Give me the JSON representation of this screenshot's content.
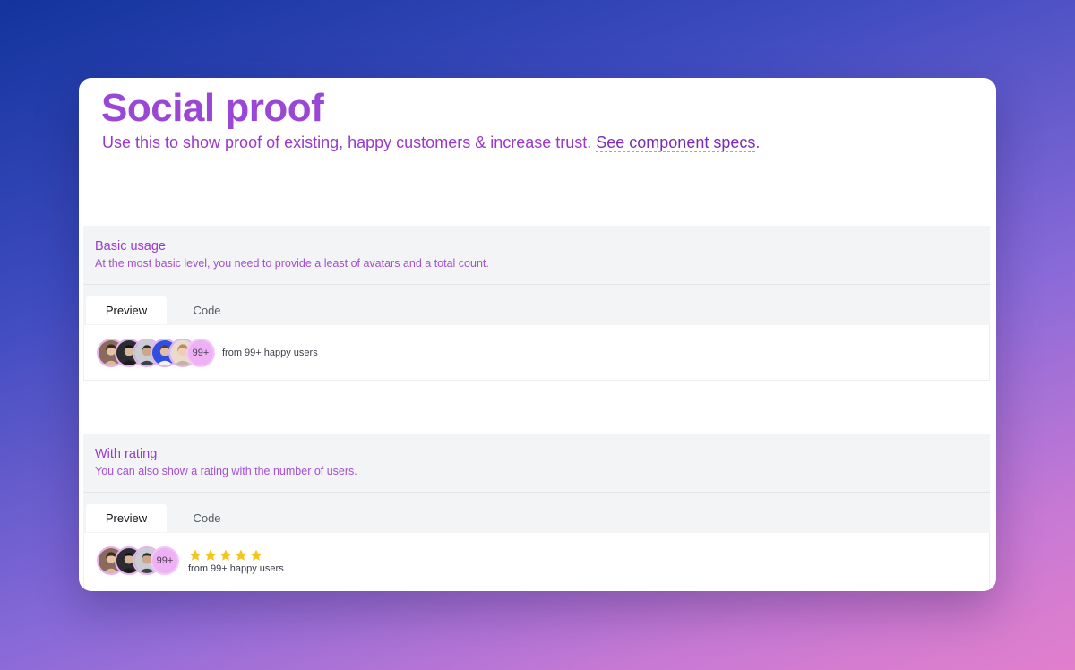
{
  "header": {
    "title": "Social proof",
    "subtitle_prefix": "Use this to show proof of existing, happy customers & increase trust. ",
    "specs_link": "See component specs",
    "subtitle_suffix": "."
  },
  "sections": [
    {
      "title": "Basic usage",
      "description": "At the most basic level, you need to provide a least of avatars and a total count.",
      "tabs": [
        {
          "label": "Preview",
          "active": true
        },
        {
          "label": "Code",
          "active": false
        }
      ],
      "preview": {
        "avatars": [
          "user-avatar-1",
          "user-avatar-2",
          "user-avatar-3",
          "user-avatar-4",
          "user-avatar-5"
        ],
        "count": "99+",
        "text": "from 99+ happy users"
      }
    },
    {
      "title": "With rating",
      "description": "You can also show a rating with the number of users.",
      "tabs": [
        {
          "label": "Preview",
          "active": true
        },
        {
          "label": "Code",
          "active": false
        }
      ],
      "preview": {
        "avatars": [
          "user-avatar-1",
          "user-avatar-2",
          "user-avatar-3"
        ],
        "count": "99+",
        "rating": 5,
        "rating_max": 5,
        "text": "from 99+ happy users"
      }
    }
  ],
  "colors": {
    "accent": "#9b47d6",
    "star": "#f5c518",
    "badge": "#eeb1f5"
  }
}
